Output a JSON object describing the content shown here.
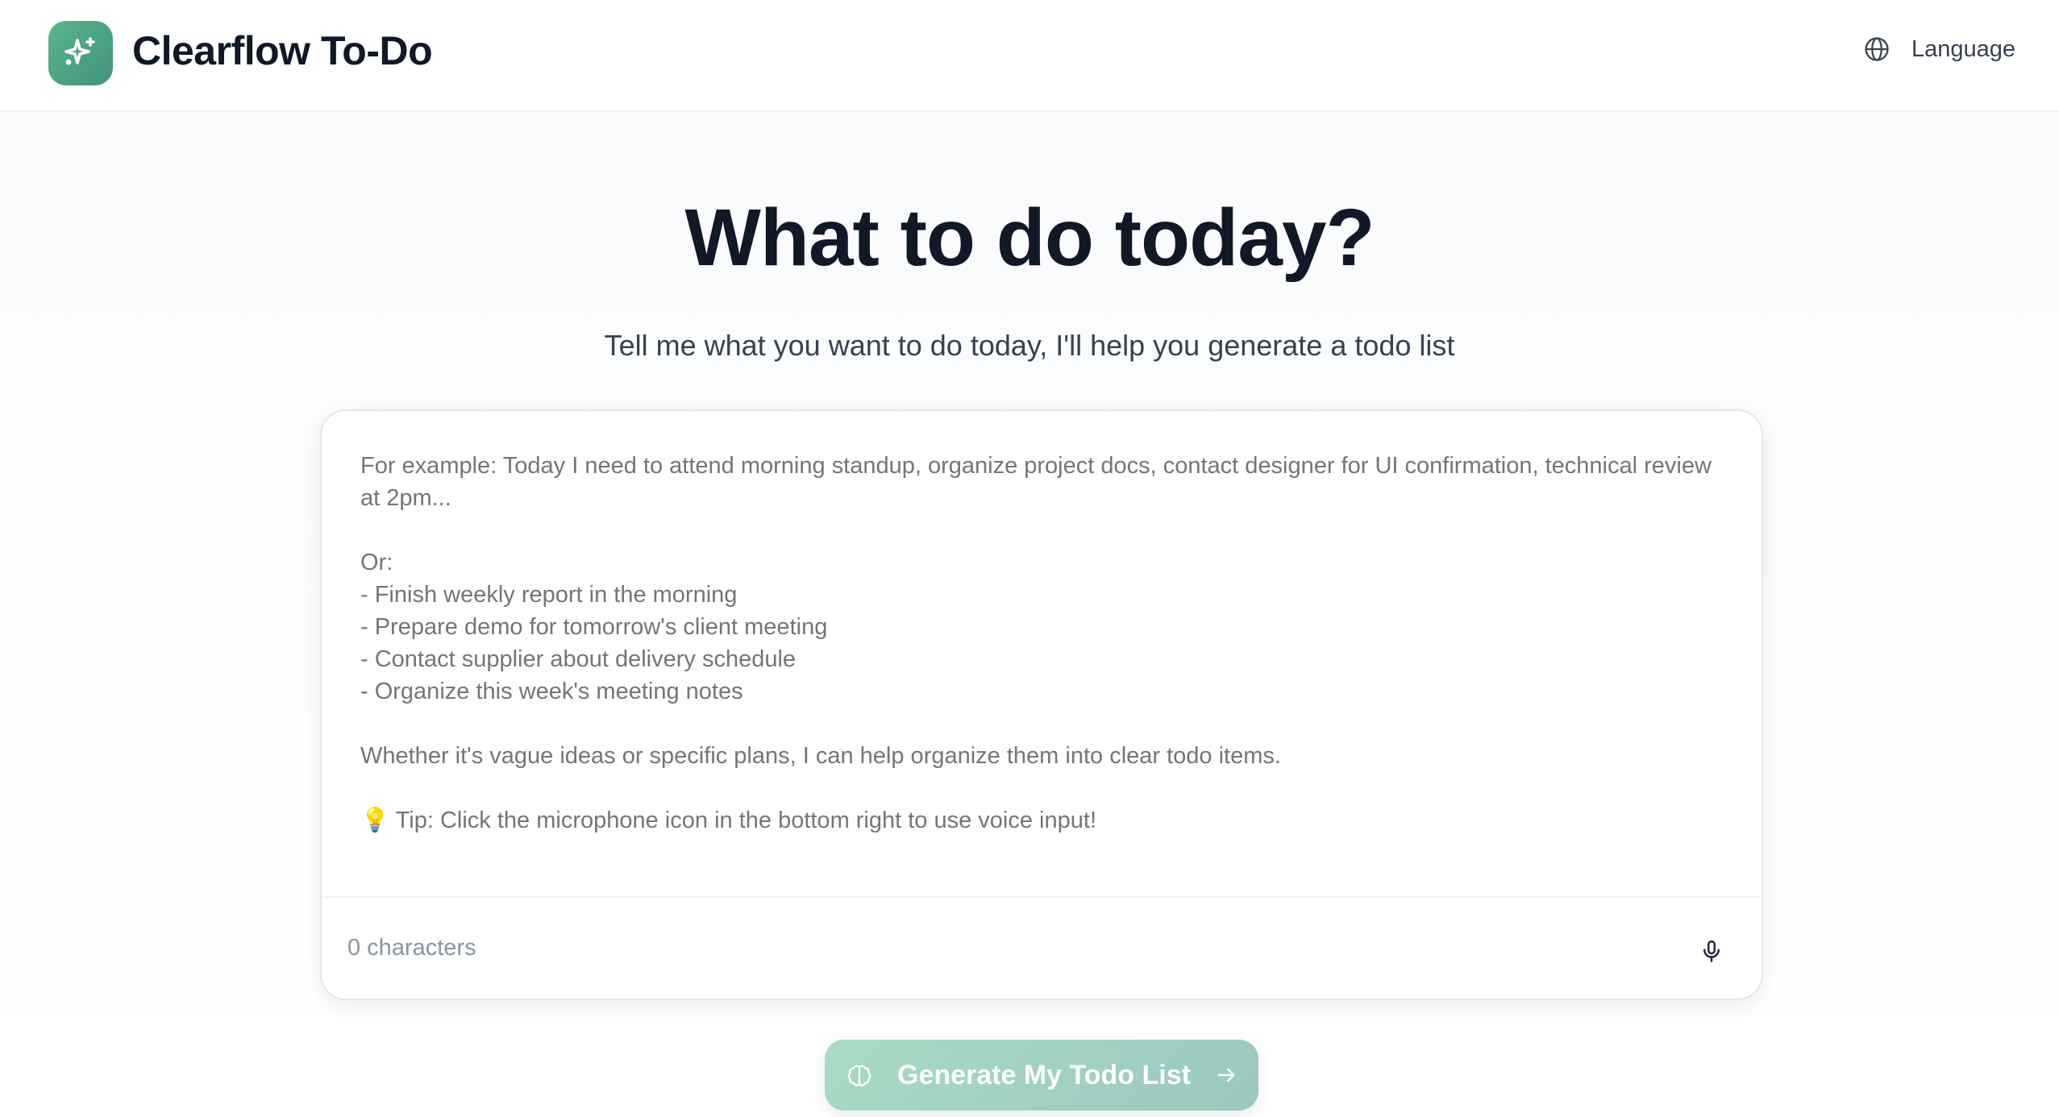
{
  "header": {
    "app_title": "Clearflow To-Do",
    "language_label": "Language",
    "logo_icon": "sparkles-icon",
    "language_icon": "globe-icon"
  },
  "main": {
    "heading": "What to do today?",
    "subtitle": "Tell me what you want to do today, I'll help you generate a todo list",
    "input": {
      "value": "",
      "placeholder": "For example: Today I need to attend morning standup, organize project docs, contact designer for UI confirmation, technical review at 2pm...\n\nOr:\n- Finish weekly report in the morning\n- Prepare demo for tomorrow's client meeting\n- Contact supplier about delivery schedule\n- Organize this week's meeting notes\n\nWhether it's vague ideas or specific plans, I can help organize them into clear todo items.\n\n💡 Tip: Click the microphone icon in the bottom right to use voice input!",
      "char_count": "0 characters",
      "mic_icon": "microphone-icon"
    },
    "generate_button": {
      "label": "Generate My Todo List",
      "icon": "brain-icon",
      "trailing_icon": "arrow-right-icon"
    }
  },
  "colors": {
    "brand": "#4fa886",
    "button": "#a5d3c3",
    "text": "#111827"
  }
}
